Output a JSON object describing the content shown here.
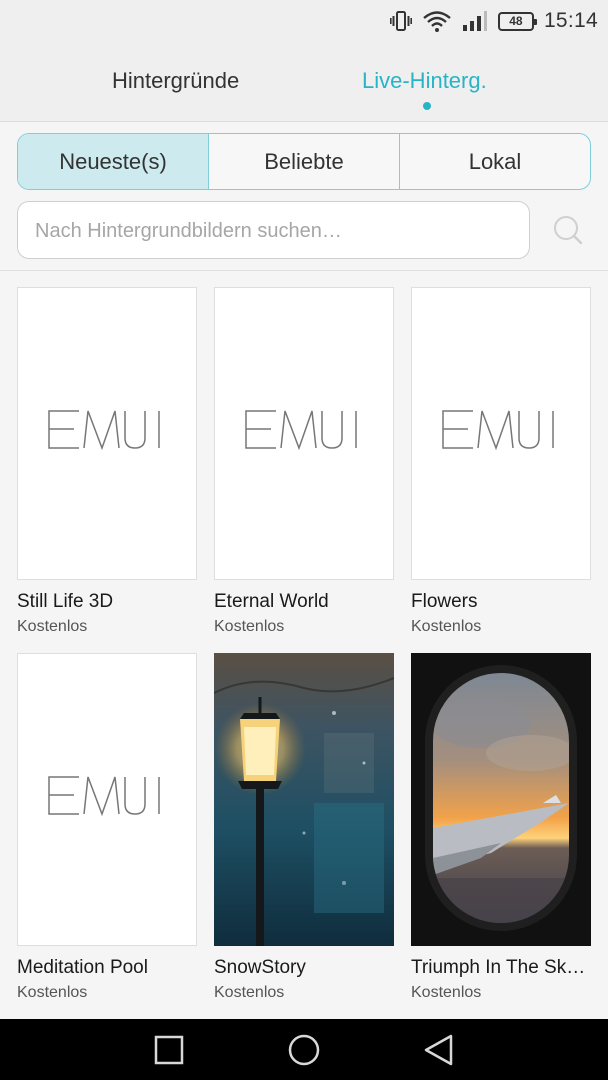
{
  "status_bar": {
    "time": "15:14",
    "battery": "48",
    "icons": [
      "vibrate-icon",
      "wifi-icon",
      "signal-icon",
      "battery-icon"
    ]
  },
  "tabs": [
    {
      "label": "Hintergründe",
      "active": false
    },
    {
      "label": "Live-Hinterg.",
      "active": true
    }
  ],
  "filters": [
    {
      "label": "Neueste(s)",
      "active": true
    },
    {
      "label": "Beliebte",
      "active": false
    },
    {
      "label": "Lokal",
      "active": false
    }
  ],
  "search": {
    "placeholder": "Nach Hintergrundbildern suchen…",
    "icon": "search-icon"
  },
  "wallpapers": [
    {
      "title": "Still Life 3D",
      "price": "Kostenlos",
      "thumbnail": "EMUI"
    },
    {
      "title": "Eternal World",
      "price": "Kostenlos",
      "thumbnail": "EMUI"
    },
    {
      "title": "Flowers",
      "price": "Kostenlos",
      "thumbnail": "EMUI"
    },
    {
      "title": "Meditation Pool",
      "price": "Kostenlos",
      "thumbnail": "EMUI"
    },
    {
      "title": "SnowStory",
      "price": "Kostenlos",
      "thumbnail": "street-lamp-image"
    },
    {
      "title": "Triumph In The Sk…",
      "price": "Kostenlos",
      "thumbnail": "airplane-window-image"
    }
  ],
  "nav_bar": {
    "buttons": [
      "recent-apps-icon",
      "home-icon",
      "back-icon"
    ]
  },
  "colors": {
    "accent": "#28b4c6",
    "segment_active_bg": "#cdebef",
    "segment_border": "#7fcfd9",
    "background": "#f5f5f5",
    "nav_bar": "#000000"
  }
}
